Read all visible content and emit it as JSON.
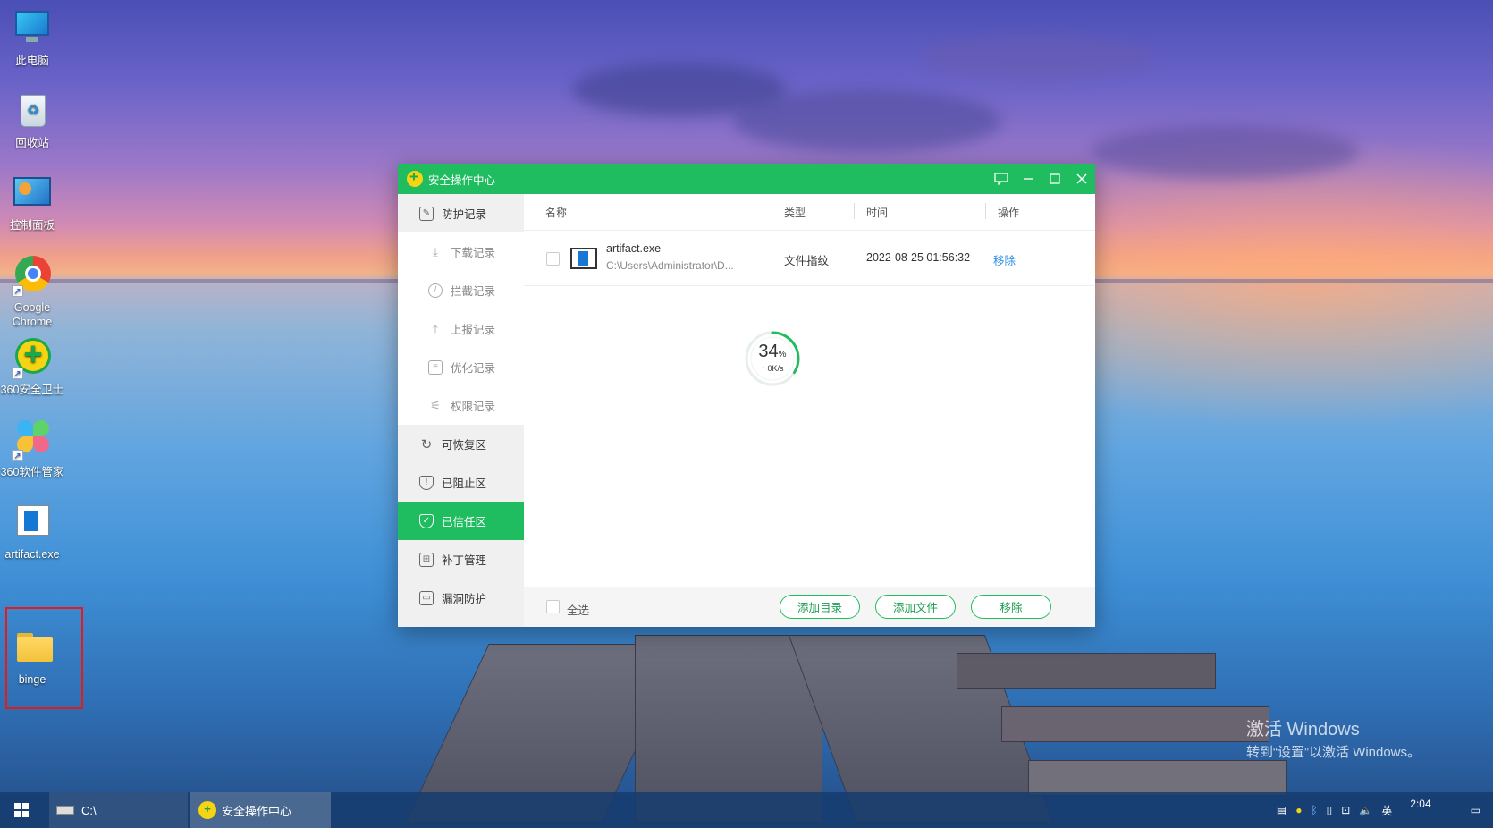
{
  "desktop": {
    "icons": [
      {
        "label": "此电脑",
        "icon": "computer-icon"
      },
      {
        "label": "回收站",
        "icon": "recycle-bin-icon"
      },
      {
        "label": "控制面板",
        "icon": "control-panel-icon"
      },
      {
        "label": "Google Chrome",
        "icon": "chrome-icon"
      },
      {
        "label": "360安全卫士",
        "icon": "360-security-icon"
      },
      {
        "label": "360软件管家",
        "icon": "360-software-manager-icon"
      },
      {
        "label": "artifact.exe",
        "icon": "exe-file-icon"
      },
      {
        "label": "binge",
        "icon": "folder-icon"
      }
    ],
    "highlight_color": "#e21c1c",
    "watermark": {
      "line1": "激活 Windows",
      "line2": "转到“设置”以激活 Windows。"
    }
  },
  "window": {
    "title": "安全操作中心",
    "accent": "#1fbd5f",
    "sidebar": {
      "items": [
        {
          "label": "防护记录",
          "icon": "edit-icon",
          "sub": false
        },
        {
          "label": "下载记录",
          "icon": "download-icon",
          "sub": true
        },
        {
          "label": "拦截记录",
          "icon": "block-icon",
          "sub": true
        },
        {
          "label": "上报记录",
          "icon": "upload-icon",
          "sub": true
        },
        {
          "label": "优化记录",
          "icon": "document-icon",
          "sub": true
        },
        {
          "label": "权限记录",
          "icon": "sliders-icon",
          "sub": true
        },
        {
          "label": "可恢复区",
          "icon": "restore-icon",
          "sub": false
        },
        {
          "label": "已阻止区",
          "icon": "shield-icon",
          "sub": false
        },
        {
          "label": "已信任区",
          "icon": "shield-check-icon",
          "sub": false,
          "active": true
        },
        {
          "label": "补丁管理",
          "icon": "grid-icon",
          "sub": false
        },
        {
          "label": "漏洞防护",
          "icon": "monitor-icon",
          "sub": false
        }
      ]
    },
    "table": {
      "headers": {
        "name": "名称",
        "type": "类型",
        "time": "时间",
        "action": "操作"
      },
      "rows": [
        {
          "name": "artifact.exe",
          "path": "C:\\Users\\Administrator\\D...",
          "type": "文件指纹",
          "time": "2022-08-25 01:56:32",
          "action": "移除"
        }
      ]
    },
    "progress": {
      "percent": 34,
      "percent_label": "34",
      "unit": "%",
      "speed": "0K/s"
    },
    "footer": {
      "select_all": "全选",
      "add_dir": "添加目录",
      "add_file": "添加文件",
      "remove": "移除"
    }
  },
  "taskbar": {
    "items": [
      {
        "label": "C:\\",
        "icon": "drive-icon"
      },
      {
        "label": "安全操作中心",
        "icon": "360-security-icon"
      }
    ],
    "tray": {
      "ime": "英",
      "time": "2:04"
    }
  }
}
